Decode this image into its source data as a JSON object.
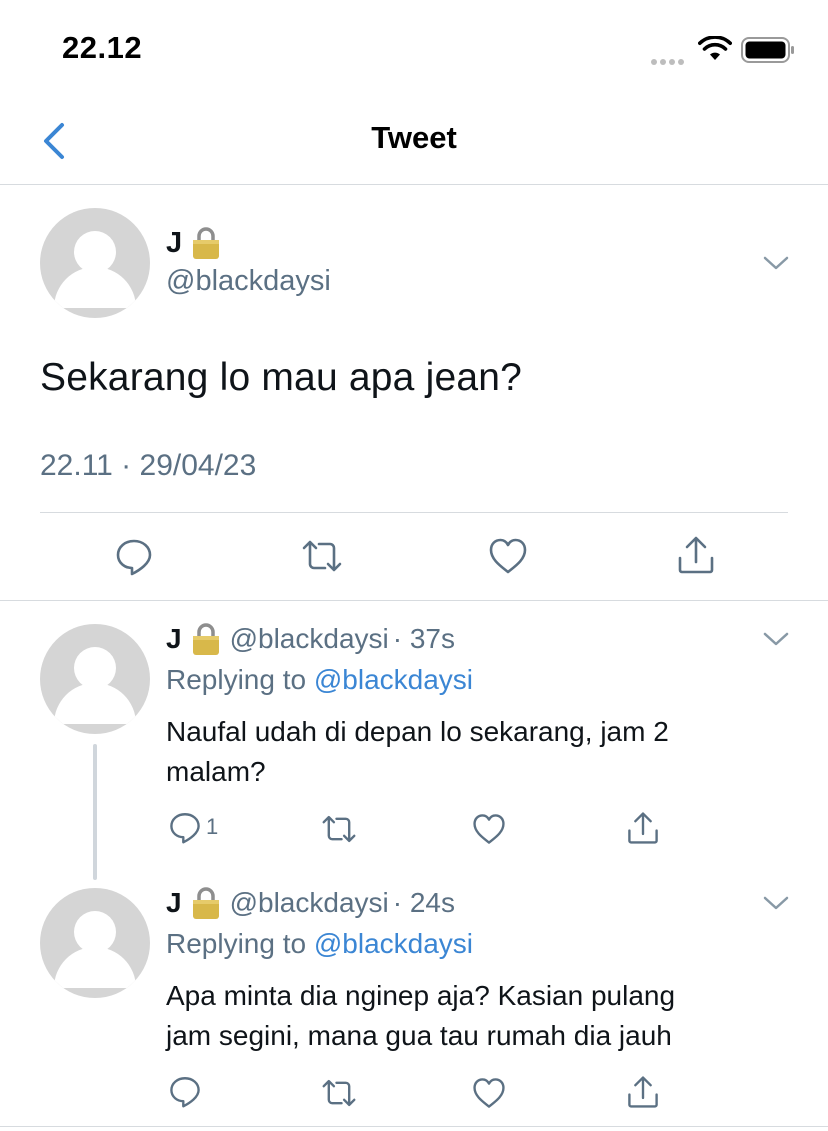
{
  "status_bar": {
    "time": "22.12"
  },
  "nav": {
    "title": "Tweet"
  },
  "main_tweet": {
    "name": "J",
    "handle": "@blackdaysi",
    "text": "Sekarang lo mau apa jean?",
    "timestamp": "22.11 · 29/04/23"
  },
  "replies": [
    {
      "name": "J",
      "handle": "@blackdaysi",
      "time": "· 37s",
      "replying_label": "Replying to",
      "replying_to": "@blackdaysi",
      "line1": "Naufal udah di depan lo sekarang, jam 2",
      "line2": "malam?",
      "reply_count": "1"
    },
    {
      "name": "J",
      "handle": "@blackdaysi",
      "time": "· 24s",
      "replying_label": "Replying to",
      "replying_to": "@blackdaysi",
      "line1": "Apa minta dia nginep aja? Kasian pulang",
      "line2": "jam segini, mana gua tau rumah dia jauh",
      "reply_count": ""
    }
  ],
  "colors": {
    "accent": "#3b86d4",
    "secondary_text": "#5b7083",
    "avatar_bg": "#d5d5d5"
  }
}
